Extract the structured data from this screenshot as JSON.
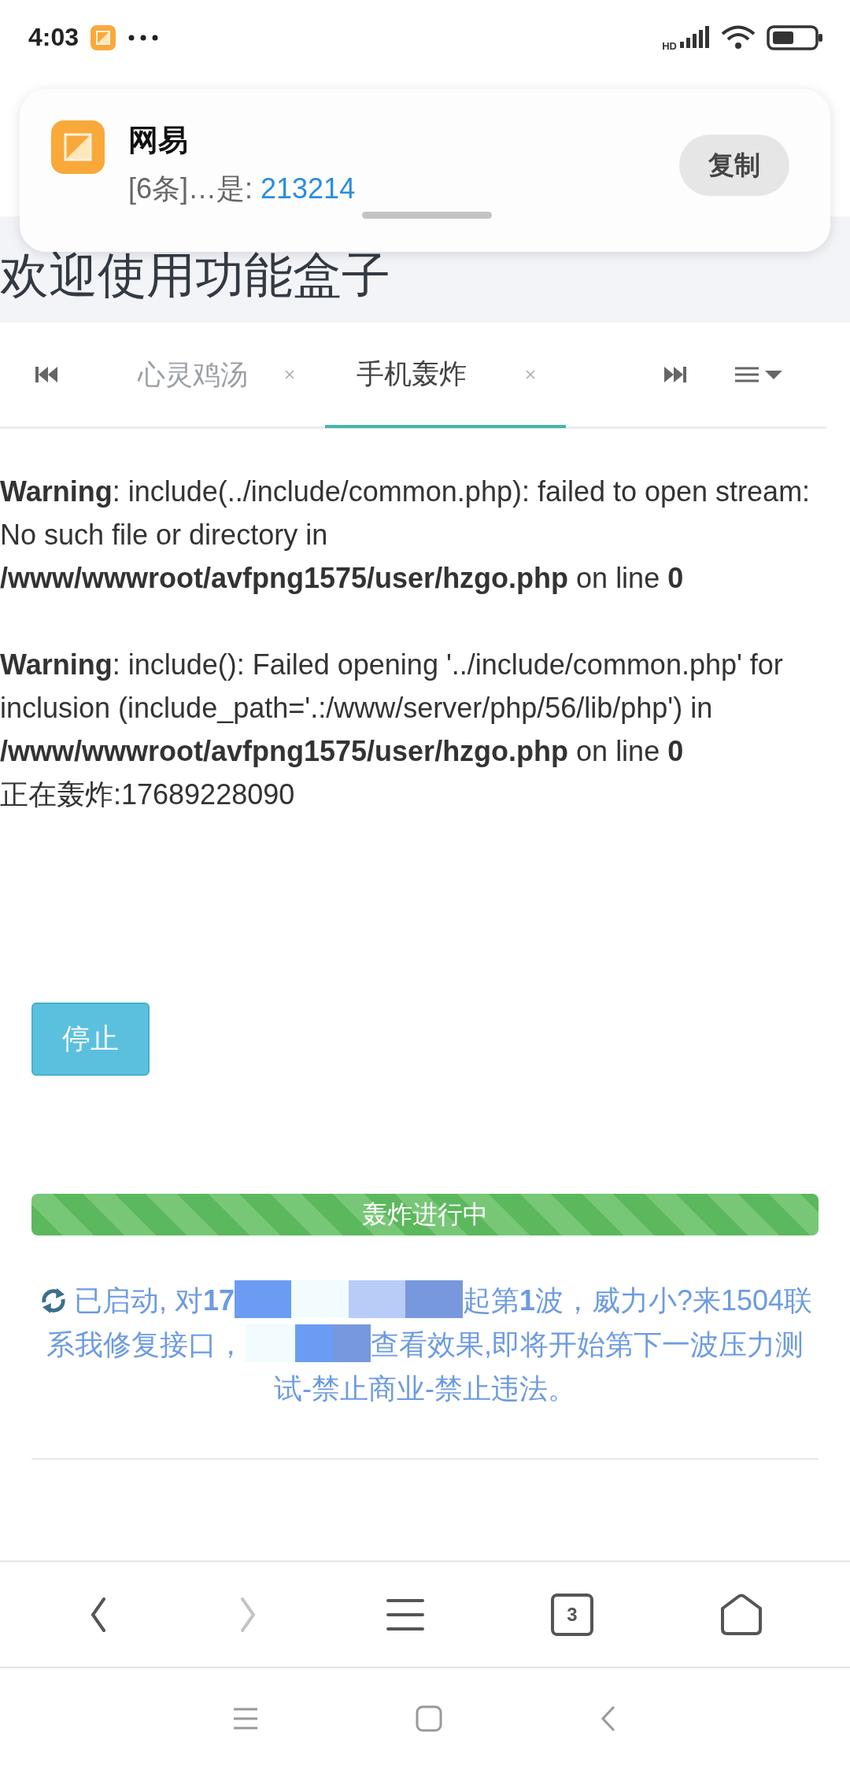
{
  "status_bar": {
    "time": "4:03",
    "network_label": "HD"
  },
  "notification": {
    "app": "网易",
    "message": "[6条]…是: ",
    "code": "213214",
    "button": "复制"
  },
  "page_title": "欢迎使用功能盒子",
  "tabs": [
    {
      "label": "心灵鸡汤",
      "selected": false
    },
    {
      "label": "手机轰炸",
      "selected": true
    }
  ],
  "warnings": [
    {
      "label": "Warning",
      "text": ": include(../include/common.php): failed to open stream: No such file or directory in ",
      "path": "/www/wwwroot/avfpng1575/user/hzgo.php",
      "suffix": " on line ",
      "line": "0"
    },
    {
      "label": "Warning",
      "text": ": include(): Failed opening '../include/common.php' for inclusion (include_path='.:/www/server/php/56/lib/php') in ",
      "path": "/www/wwwroot/avfpng1575/user/hzgo.php",
      "suffix": " on line ",
      "line": "0"
    }
  ],
  "target_line": "正在轰炸:17689228090",
  "stop_button": "停止",
  "progress": {
    "label": "轰炸进行中",
    "level": 1
  },
  "status_message": {
    "before": "已启动, 对**17**",
    "middle": "起第**1**波，威力小?来1504联系我修复接口，",
    "after": "查看效果,即将开始第下一波压力测试-禁止商业-禁止违法。"
  },
  "browser_bar": {
    "tab_count": "3",
    "forward_disabled": true
  }
}
